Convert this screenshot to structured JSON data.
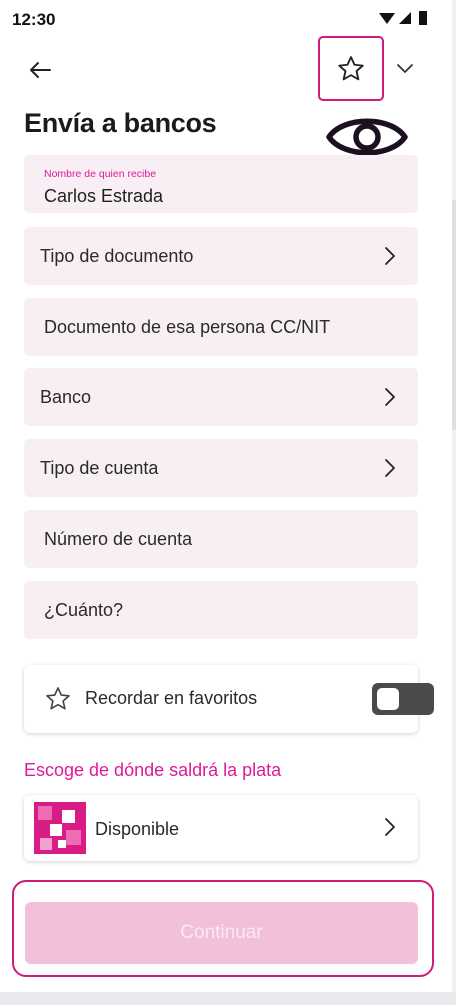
{
  "status_bar": {
    "time": "12:30",
    "icons": [
      "wifi-icon",
      "signal-icon",
      "battery-icon"
    ]
  },
  "header": {
    "back_icon": "arrow-left-icon",
    "favorite_icon": "star-outline-icon",
    "menu_icon": "chevron-down-icon",
    "title": "Envía a bancos",
    "visibility_icon": "eye-icon"
  },
  "form": {
    "recipient": {
      "label": "Nombre de quien recibe",
      "value": "Carlos Estrada"
    },
    "document_type": {
      "placeholder": "Tipo de documento"
    },
    "document_number": {
      "placeholder": "Documento de esa persona CC/NIT"
    },
    "bank": {
      "placeholder": "Banco"
    },
    "account_type": {
      "placeholder": "Tipo de cuenta"
    },
    "account_number": {
      "placeholder": "Número de cuenta"
    },
    "amount": {
      "placeholder": "¿Cuánto?"
    }
  },
  "favorites": {
    "label": "Recordar en favoritos",
    "enabled": false
  },
  "source": {
    "heading": "Escoge de dónde saldrá la plata",
    "account_label": "Disponible"
  },
  "actions": {
    "continue_label": "Continuar",
    "continue_enabled": false
  },
  "colors": {
    "accent": "#e0199a",
    "highlight_outline": "#d2197e",
    "field_background": "#f7eff4",
    "button_disabled": "#f2c0da",
    "toggle_off": "#4a4a4a"
  }
}
